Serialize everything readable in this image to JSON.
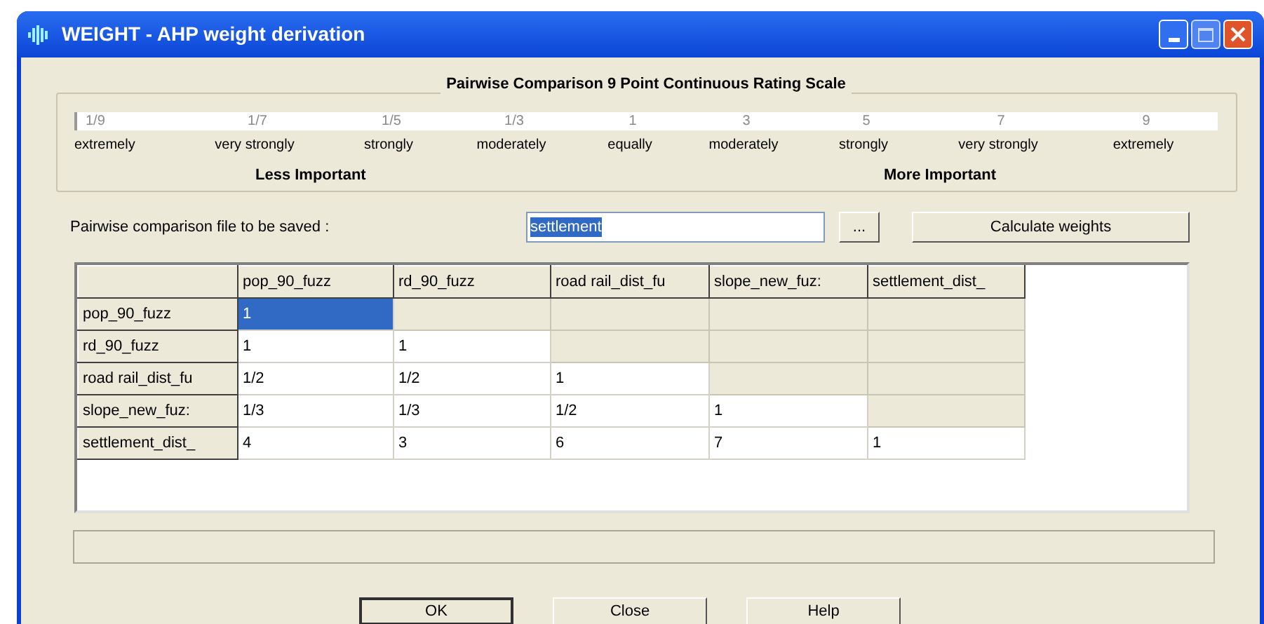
{
  "window": {
    "title": "WEIGHT - AHP weight derivation"
  },
  "scale": {
    "title": "Pairwise Comparison 9 Point Continuous Rating Scale",
    "points": [
      {
        "value": "1/9",
        "label": "extremely"
      },
      {
        "value": "1/7",
        "label": "very strongly"
      },
      {
        "value": "1/5",
        "label": "strongly"
      },
      {
        "value": "1/3",
        "label": "moderately"
      },
      {
        "value": "1",
        "label": "equally"
      },
      {
        "value": "3",
        "label": "moderately"
      },
      {
        "value": "5",
        "label": "strongly"
      },
      {
        "value": "7",
        "label": "very strongly"
      },
      {
        "value": "9",
        "label": "extremely"
      }
    ],
    "less_label": "Less Important",
    "more_label": "More Important"
  },
  "file": {
    "label": "Pairwise comparison file to be saved :",
    "value": "settlement",
    "browse_button": "...",
    "calculate_button": "Calculate weights"
  },
  "table": {
    "columns": [
      "pop_90_fuzz",
      "rd_90_fuzz",
      "road rail_dist_fu",
      "slope_new_fuz:",
      "settlement_dist_"
    ],
    "rows": [
      {
        "header": "pop_90_fuzz",
        "cells": [
          {
            "value": "1",
            "selected": true,
            "disabled": false
          },
          {
            "selected": false,
            "disabled": true
          },
          {
            "selected": false,
            "disabled": true
          },
          {
            "selected": false,
            "disabled": true
          },
          {
            "selected": false,
            "disabled": true
          }
        ]
      },
      {
        "header": "rd_90_fuzz",
        "cells": [
          {
            "value": "1",
            "selected": false,
            "disabled": false
          },
          {
            "value": "1",
            "selected": false,
            "disabled": false
          },
          {
            "selected": false,
            "disabled": true
          },
          {
            "selected": false,
            "disabled": true
          },
          {
            "selected": false,
            "disabled": true
          }
        ]
      },
      {
        "header": "road rail_dist_fu",
        "cells": [
          {
            "value": "1/2",
            "selected": false,
            "disabled": false
          },
          {
            "value": "1/2",
            "selected": false,
            "disabled": false
          },
          {
            "value": "1",
            "selected": false,
            "disabled": false
          },
          {
            "selected": false,
            "disabled": true
          },
          {
            "selected": false,
            "disabled": true
          }
        ]
      },
      {
        "header": "slope_new_fuz:",
        "cells": [
          {
            "value": "1/3",
            "selected": false,
            "disabled": false
          },
          {
            "value": "1/3",
            "selected": false,
            "disabled": false
          },
          {
            "value": "1/2",
            "selected": false,
            "disabled": false
          },
          {
            "value": "1",
            "selected": false,
            "disabled": false
          },
          {
            "selected": false,
            "disabled": true
          }
        ]
      },
      {
        "header": "settlement_dist_",
        "cells": [
          {
            "value": "4",
            "selected": false,
            "disabled": false
          },
          {
            "value": "3",
            "selected": false,
            "disabled": false
          },
          {
            "value": "6",
            "selected": false,
            "disabled": false
          },
          {
            "value": "7",
            "selected": false,
            "disabled": false
          },
          {
            "value": "1",
            "selected": false,
            "disabled": false
          }
        ]
      }
    ]
  },
  "buttons": [
    {
      "label": "OK",
      "default": true
    },
    {
      "label": "Close",
      "default": false
    },
    {
      "label": "Help",
      "default": false
    }
  ]
}
